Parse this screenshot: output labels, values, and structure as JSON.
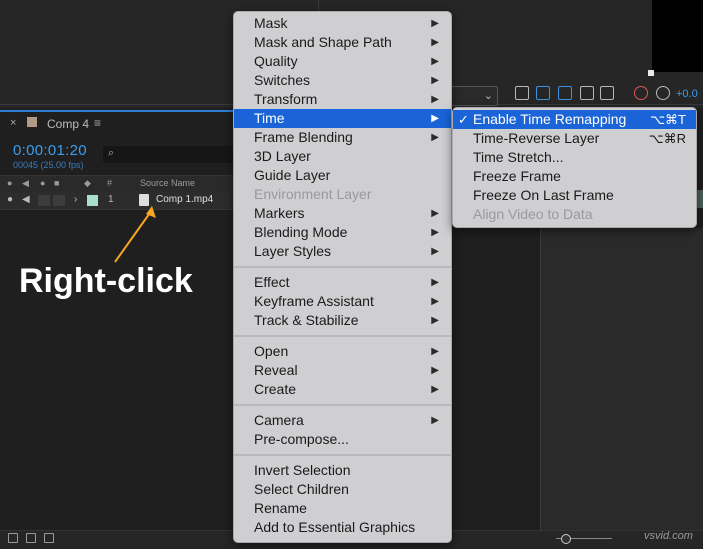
{
  "composition": {
    "tab_close": "×",
    "tab_title": "Comp 4",
    "tab_menu": "≡",
    "timecode": "0:00:01:20",
    "frames_info": "00045 (25.00 fps)",
    "search_icon": "⌕",
    "toolbar_value": "+0.0",
    "headers": {
      "tag": "#",
      "source_name": "Source Name"
    },
    "layer": {
      "expand": "›",
      "number": "1",
      "name": "Comp 1.mp4"
    }
  },
  "annotation": {
    "text": "Right-click",
    "arrow_color": "#f5a623"
  },
  "context_menu": {
    "groups": [
      [
        {
          "label": "Mask",
          "submenu": true
        },
        {
          "label": "Mask and Shape Path",
          "submenu": true
        },
        {
          "label": "Quality",
          "submenu": true
        },
        {
          "label": "Switches",
          "submenu": true
        },
        {
          "label": "Transform",
          "submenu": true
        },
        {
          "label": "Time",
          "submenu": true,
          "active": true
        },
        {
          "label": "Frame Blending",
          "submenu": true
        },
        {
          "label": "3D Layer"
        },
        {
          "label": "Guide Layer"
        },
        {
          "label": "Environment Layer",
          "disabled": true
        },
        {
          "label": "Markers",
          "submenu": true
        },
        {
          "label": "Blending Mode",
          "submenu": true
        },
        {
          "label": "Layer Styles",
          "submenu": true
        }
      ],
      [
        {
          "label": "Effect",
          "submenu": true
        },
        {
          "label": "Keyframe Assistant",
          "submenu": true
        },
        {
          "label": "Track & Stabilize",
          "submenu": true
        }
      ],
      [
        {
          "label": "Open",
          "submenu": true
        },
        {
          "label": "Reveal",
          "submenu": true
        },
        {
          "label": "Create",
          "submenu": true
        }
      ],
      [
        {
          "label": "Camera",
          "submenu": true
        },
        {
          "label": "Pre-compose..."
        }
      ],
      [
        {
          "label": "Invert Selection"
        },
        {
          "label": "Select Children"
        },
        {
          "label": "Rename"
        },
        {
          "label": "Add to Essential Graphics"
        }
      ]
    ]
  },
  "time_submenu": [
    {
      "label": "Enable Time Remapping",
      "shortcut": "⌥⌘T",
      "checked": true,
      "active": true
    },
    {
      "label": "Time-Reverse Layer",
      "shortcut": "⌥⌘R"
    },
    {
      "label": "Time Stretch..."
    },
    {
      "label": "Freeze Frame"
    },
    {
      "label": "Freeze On Last Frame"
    },
    {
      "label": "Align Video to Data",
      "disabled": true
    }
  ],
  "watermark": "vsvid.com",
  "colors": {
    "accent": "#1a64d8",
    "timecode": "#3d9bf0",
    "menu_bg": "#cfcfd2"
  }
}
